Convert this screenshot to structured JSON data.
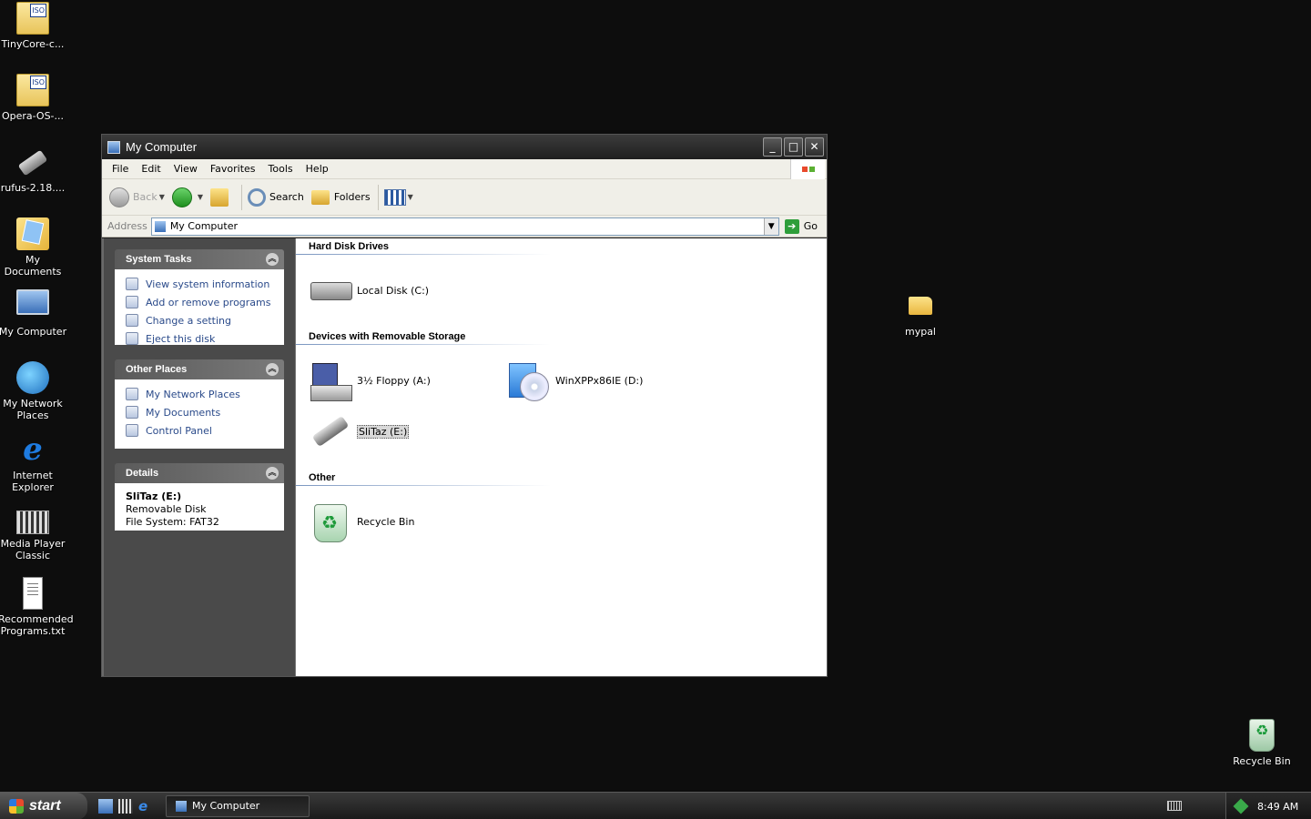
{
  "desktop": {
    "icons": [
      {
        "label": "TinyCore-c..."
      },
      {
        "label": "Opera-OS-..."
      },
      {
        "label": "rufus-2.18...."
      },
      {
        "label": "My Documents"
      },
      {
        "label": "My Computer"
      },
      {
        "label": "My Network Places"
      },
      {
        "label": "Internet Explorer"
      },
      {
        "label": "Media Player Classic"
      },
      {
        "label": "Recommended Programs.txt"
      }
    ],
    "mypal": "mypal",
    "recycle_bin": "Recycle Bin"
  },
  "window": {
    "title": "My Computer",
    "menu": [
      "File",
      "Edit",
      "View",
      "Favorites",
      "Tools",
      "Help"
    ],
    "toolbar": {
      "back": "Back",
      "search": "Search",
      "folders": "Folders"
    },
    "address": {
      "label": "Address",
      "value": "My Computer",
      "go": "Go"
    },
    "sidebar": {
      "system_tasks": {
        "title": "System Tasks",
        "items": [
          "View system information",
          "Add or remove programs",
          "Change a setting",
          "Eject this disk"
        ]
      },
      "other_places": {
        "title": "Other Places",
        "items": [
          "My Network Places",
          "My Documents",
          "Control Panel"
        ]
      },
      "details": {
        "title": "Details",
        "name": "SliTaz (E:)",
        "type": "Removable Disk",
        "fs": "File System: FAT32"
      }
    },
    "groups": {
      "hard_disk": {
        "title": "Hard Disk Drives",
        "items": [
          "Local Disk (C:)"
        ]
      },
      "removable": {
        "title": "Devices with Removable Storage",
        "items": [
          "3½ Floppy (A:)",
          "WinXPPx86IE (D:)",
          "SliTaz (E:)"
        ]
      },
      "other": {
        "title": "Other",
        "items": [
          "Recycle Bin"
        ]
      }
    }
  },
  "taskbar": {
    "start": "start",
    "task": "My Computer",
    "clock": "8:49 AM"
  }
}
